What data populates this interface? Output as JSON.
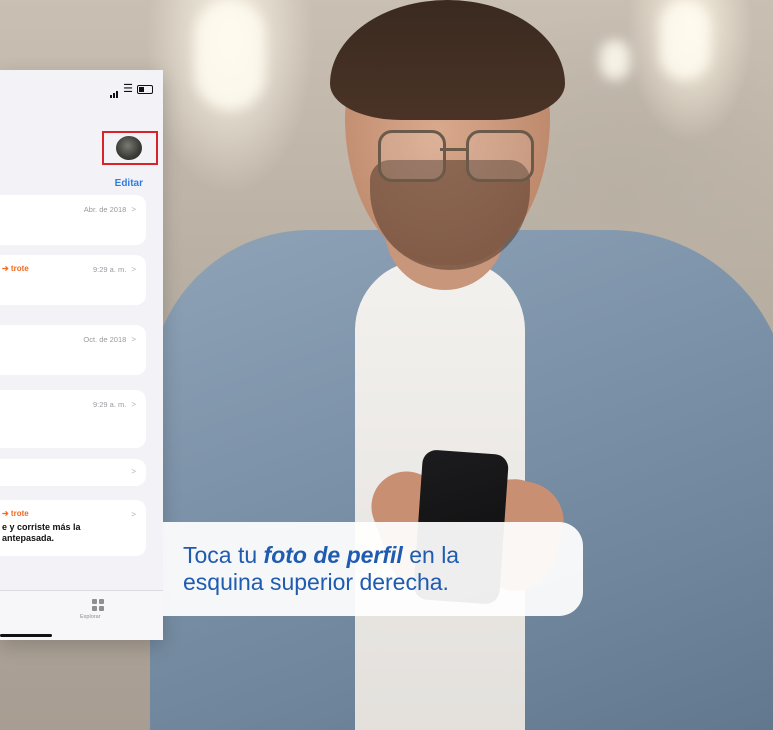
{
  "phone": {
    "edit_label": "Editar",
    "cards": [
      {
        "date": "Abr. de 2018"
      },
      {
        "activity": "➔ trote",
        "time": "9:29 a. m."
      },
      {
        "date": "Oct. de 2018"
      },
      {
        "time": "9:29 a. m."
      },
      {},
      {
        "activity": "➔ trote",
        "note_line1": "e y corriste más la",
        "note_line2": "antepasada."
      }
    ],
    "chevron": ">",
    "tab_label": "Explorar"
  },
  "caption": {
    "part1": "Toca tu ",
    "emphasis": "foto de perfil",
    "part2": " en la",
    "line2": "esquina superior derecha."
  },
  "colors": {
    "accent_blue": "#2f7de1",
    "caption_blue": "#1f5bb0",
    "highlight_red": "#d8232a",
    "activity_orange": "#f06a22"
  }
}
